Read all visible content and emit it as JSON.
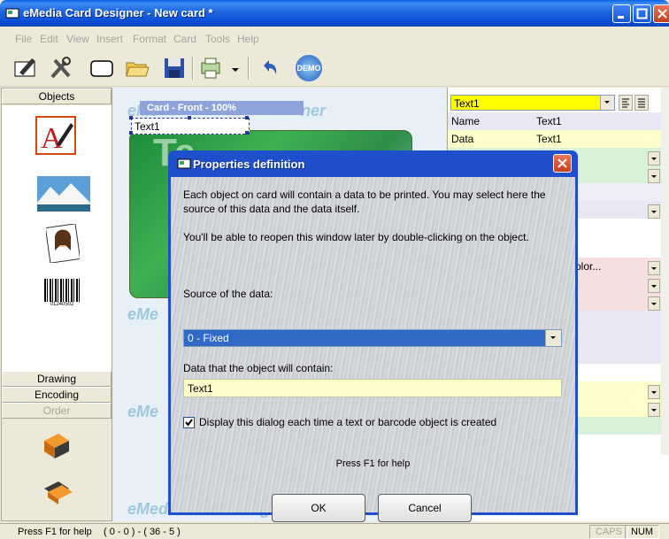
{
  "window": {
    "title": "eMedia Card Designer - New card *"
  },
  "menu": [
    "File",
    "Edit",
    "View",
    "Insert",
    "Format",
    "Card",
    "Tools",
    "Help"
  ],
  "toolbar": {
    "demo_label": "DEMO"
  },
  "left_panel": {
    "tabs": [
      "Objects",
      "Drawing",
      "Encoding",
      "Order"
    ],
    "objects": [
      "text-icon",
      "image-icon",
      "photo-icon",
      "barcode-icon"
    ],
    "barcode_digits": "01240502"
  },
  "canvas": {
    "card_label": "Card - Front - 100%",
    "text_object": "Text1",
    "watermark": "eMedia Card Designer",
    "watermark_short": "eMe"
  },
  "properties": {
    "selected_object": "Text1",
    "rows": [
      {
        "key": "Name",
        "value": "Text1"
      },
      {
        "key": "Data",
        "value": "Text1"
      }
    ],
    "partial_value": "olor..."
  },
  "dialog": {
    "title": "Properties definition",
    "intro": "Each object on card will contain a data to be printed. You may select here the source of this data and the data itself.",
    "reopen_hint": "You'll be able to reopen this window later by double-clicking on the object.",
    "source_label": "Source of the data:",
    "source_value": "0 - Fixed",
    "data_label": "Data that the object will contain:",
    "data_value": "Text1",
    "checkbox_label": "Display this dialog each time a text or barcode object is created",
    "checkbox_checked": true,
    "help_text": "Press F1 for help",
    "ok_label": "OK",
    "cancel_label": "Cancel"
  },
  "status": {
    "help": "Press F1 for help",
    "coords": "( 0 - 0 ) - ( 36 - 5 )",
    "caps": "CAPS",
    "num": "NUM"
  }
}
